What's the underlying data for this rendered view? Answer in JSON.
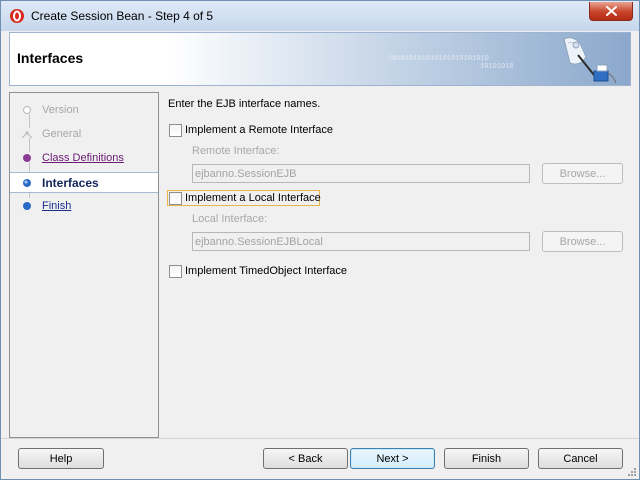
{
  "window": {
    "title": "Create Session Bean - Step 4 of 5"
  },
  "header": {
    "title": "Interfaces",
    "binary_text_1": "101010101010101010101010",
    "binary_text_2": "10101010"
  },
  "steps": [
    {
      "label": "Version",
      "state": "disabled"
    },
    {
      "label": "General",
      "state": "disabled"
    },
    {
      "label": "Class Definitions",
      "state": "visited"
    },
    {
      "label": "Interfaces",
      "state": "current"
    },
    {
      "label": "Finish",
      "state": "link"
    }
  ],
  "content": {
    "intro": "Enter the EJB interface names.",
    "remote": {
      "checkbox_label": "Implement a Remote Interface",
      "checked": false,
      "field_label": "Remote Interface:",
      "value": "ejbanno.SessionEJB",
      "browse_label": "Browse..."
    },
    "local": {
      "checkbox_label": "Implement a Local Interface",
      "checked": false,
      "field_label": "Local Interface:",
      "value": "ejbanno.SessionEJBLocal",
      "browse_label": "Browse..."
    },
    "timed": {
      "checkbox_label": "Implement TimedObject Interface",
      "checked": false
    }
  },
  "buttons": {
    "help": "Help",
    "back": "< Back",
    "next": "Next >",
    "finish": "Finish",
    "cancel": "Cancel"
  },
  "colors": {
    "accent_link": "#1a2e8a",
    "visited_link": "#6a1a72",
    "focus": "#e8b54b",
    "close": "#c7432a"
  },
  "icons": {
    "app": "oracle-app-icon",
    "close": "close-icon",
    "header": "session-bean-art-icon"
  }
}
